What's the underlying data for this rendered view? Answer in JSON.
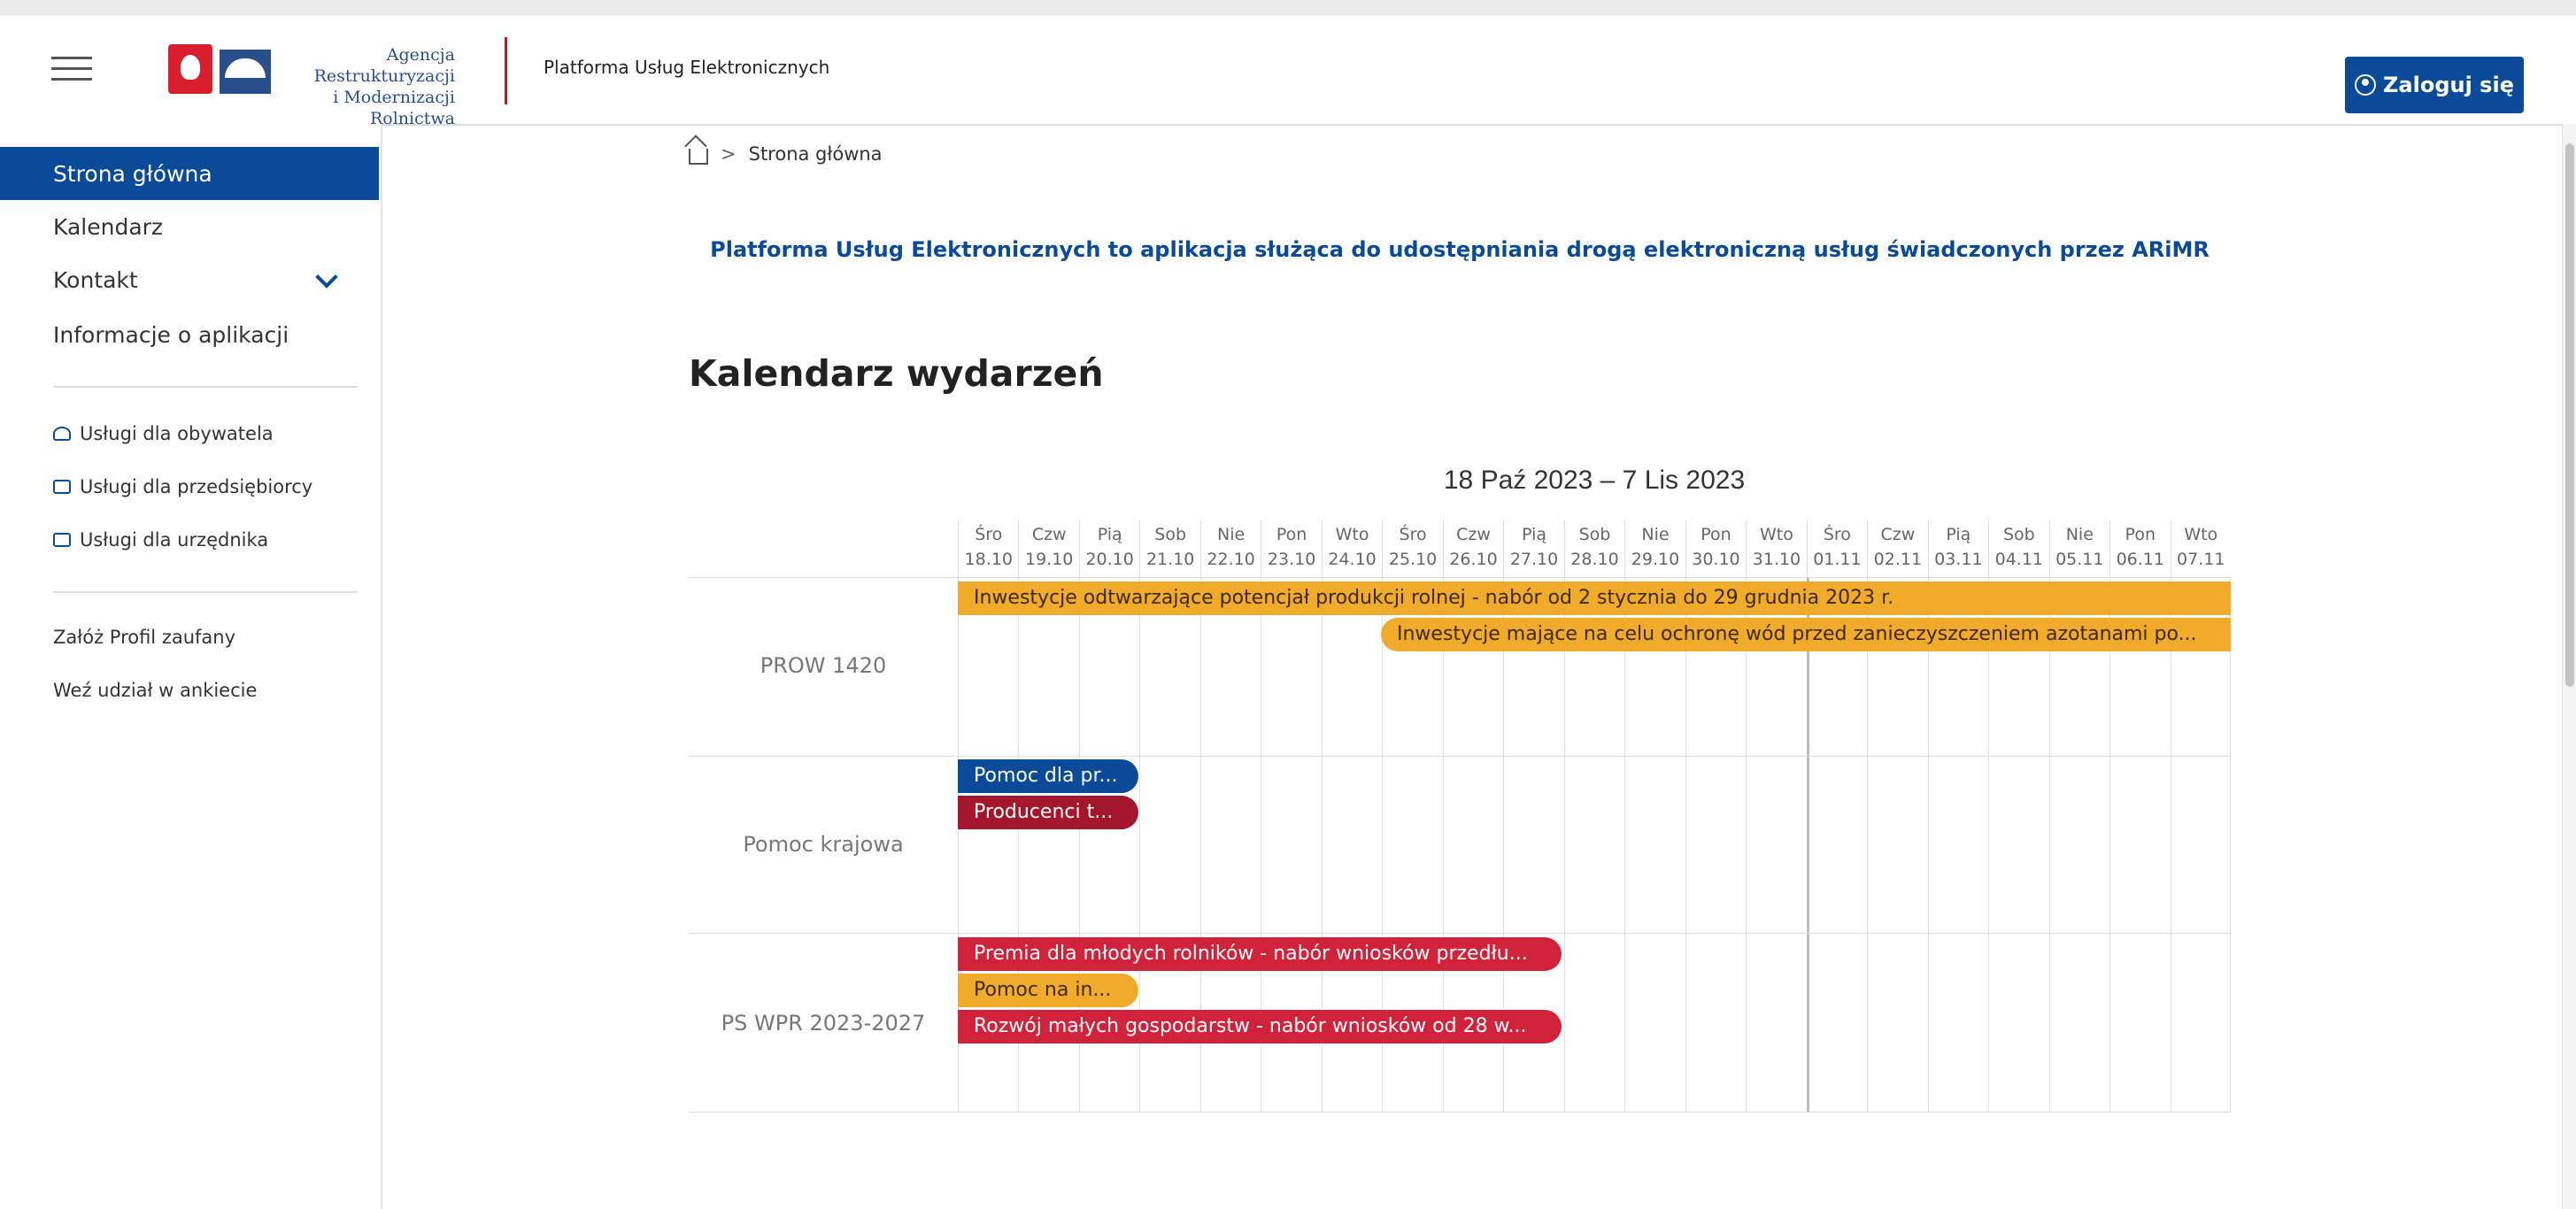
{
  "header": {
    "logo_line1": "Agencja Restrukturyzacji",
    "logo_line2": "i Modernizacji Rolnictwa",
    "logo_badge": "ARiMR",
    "app_name": "Platforma Usług Elektronicznych",
    "login_label": "Zaloguj się"
  },
  "sidebar": {
    "items": [
      {
        "label": "Strona główna"
      },
      {
        "label": "Kalendarz"
      },
      {
        "label": "Kontakt"
      },
      {
        "label": "Informacje o aplikacji"
      }
    ],
    "services": [
      {
        "label": "Usługi dla obywatela",
        "icon": "person-icon"
      },
      {
        "label": "Usługi dla przedsiębiorcy",
        "icon": "briefcase-icon"
      },
      {
        "label": "Usługi dla urzędnika",
        "icon": "laptop-icon"
      }
    ],
    "links": [
      {
        "label": "Załóż Profil zaufany"
      },
      {
        "label": "Weź udział w ankiecie"
      }
    ]
  },
  "breadcrumb": {
    "separator": ">",
    "current": "Strona główna"
  },
  "intro": "Platforma Usług Elektronicznych to aplikacja służąca do udostępniania drogą elektroniczną usług świadczonych przez ARiMR",
  "calendar": {
    "heading": "Kalendarz wydarzeń",
    "range": "18 Paź 2023 – 7 Lis 2023",
    "days": [
      {
        "dow": "Śro",
        "date": "18.10"
      },
      {
        "dow": "Czw",
        "date": "19.10"
      },
      {
        "dow": "Pią",
        "date": "20.10"
      },
      {
        "dow": "Sob",
        "date": "21.10"
      },
      {
        "dow": "Nie",
        "date": "22.10"
      },
      {
        "dow": "Pon",
        "date": "23.10"
      },
      {
        "dow": "Wto",
        "date": "24.10"
      },
      {
        "dow": "Śro",
        "date": "25.10"
      },
      {
        "dow": "Czw",
        "date": "26.10"
      },
      {
        "dow": "Pią",
        "date": "27.10"
      },
      {
        "dow": "Sob",
        "date": "28.10"
      },
      {
        "dow": "Nie",
        "date": "29.10"
      },
      {
        "dow": "Pon",
        "date": "30.10"
      },
      {
        "dow": "Wto",
        "date": "31.10"
      },
      {
        "dow": "Śro",
        "date": "01.11"
      },
      {
        "dow": "Czw",
        "date": "02.11"
      },
      {
        "dow": "Pią",
        "date": "03.11"
      },
      {
        "dow": "Sob",
        "date": "04.11"
      },
      {
        "dow": "Nie",
        "date": "05.11"
      },
      {
        "dow": "Pon",
        "date": "06.11"
      },
      {
        "dow": "Wto",
        "date": "07.11"
      }
    ],
    "groups": [
      {
        "label": "PROW 1420"
      },
      {
        "label": "Pomoc krajowa"
      },
      {
        "label": "PS WPR 2023-2027"
      }
    ],
    "events": [
      {
        "title": "Inwestycje odtwarzające potencjał produkcji rolnej - nabór od 2 stycznia do 29 grudnia 2023 r.",
        "group": "PROW 1420",
        "color": "#f0ab2a"
      },
      {
        "title": "Inwestycje mające na celu ochronę wód przed zanieczyszczeniem azotanami po...",
        "group": "PROW 1420",
        "color": "#f0ab2a"
      },
      {
        "title": "Pomoc dla pr...",
        "group": "Pomoc krajowa",
        "color": "#0b4a98"
      },
      {
        "title": "Producenci t...",
        "group": "Pomoc krajowa",
        "color": "#a3162c"
      },
      {
        "title": "Premia dla młodych rolników - nabór wniosków przedłu...",
        "group": "PS WPR 2023-2027",
        "color": "#d1223b"
      },
      {
        "title": "Pomoc na in...",
        "group": "PS WPR 2023-2027",
        "color": "#f0ab2a"
      },
      {
        "title": "Rozwój małych gospodarstw - nabór wniosków od 28 w...",
        "group": "PS WPR 2023-2027",
        "color": "#d1223b"
      }
    ]
  },
  "colors": {
    "brand": "#0b4a98",
    "accent_red": "#b01e2a"
  }
}
